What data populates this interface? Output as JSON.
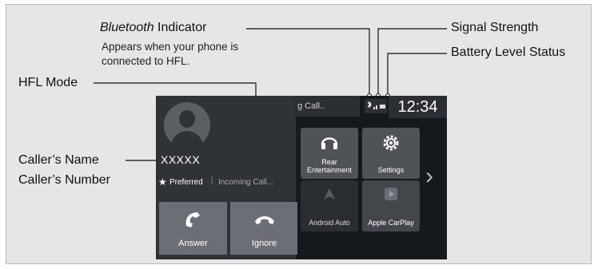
{
  "callouts": {
    "bluetooth_prefix": "Bluetooth",
    "bluetooth_suffix": " Indicator",
    "bluetooth_note_line1": "Appears when your phone is",
    "bluetooth_note_line2": "connected to HFL.",
    "signal_strength": "Signal Strength",
    "battery_level": "Battery Level Status",
    "hfl_mode": "HFL Mode",
    "callers_name": "Caller’s Name",
    "callers_number": "Caller’s Number"
  },
  "screen": {
    "caller_name": "XXXXX",
    "preferred": "Preferred",
    "separator": "|",
    "hfl_mode_value": "Incoming Call...",
    "answer_label": "Answer",
    "ignore_label": "Ignore",
    "banner_text": "g Call..",
    "time": "12:34",
    "tiles": {
      "rear_entertainment": "Rear Entertainment",
      "settings": "Settings",
      "android_auto": "Android Auto",
      "apple_carplay": "Apple CarPlay"
    },
    "chevron": "›",
    "star": "★"
  },
  "icons": [
    "avatar-icon",
    "answer-phone-icon",
    "ignore-phone-icon",
    "headphones-icon",
    "gear-icon",
    "android-auto-icon",
    "carplay-icon",
    "bluetooth-icon",
    "signal-icon",
    "battery-icon"
  ],
  "colors": {
    "frame_bg": "#e6e6e6",
    "screen_bg": "#171a1f",
    "button_gray": "#6b6f75"
  }
}
